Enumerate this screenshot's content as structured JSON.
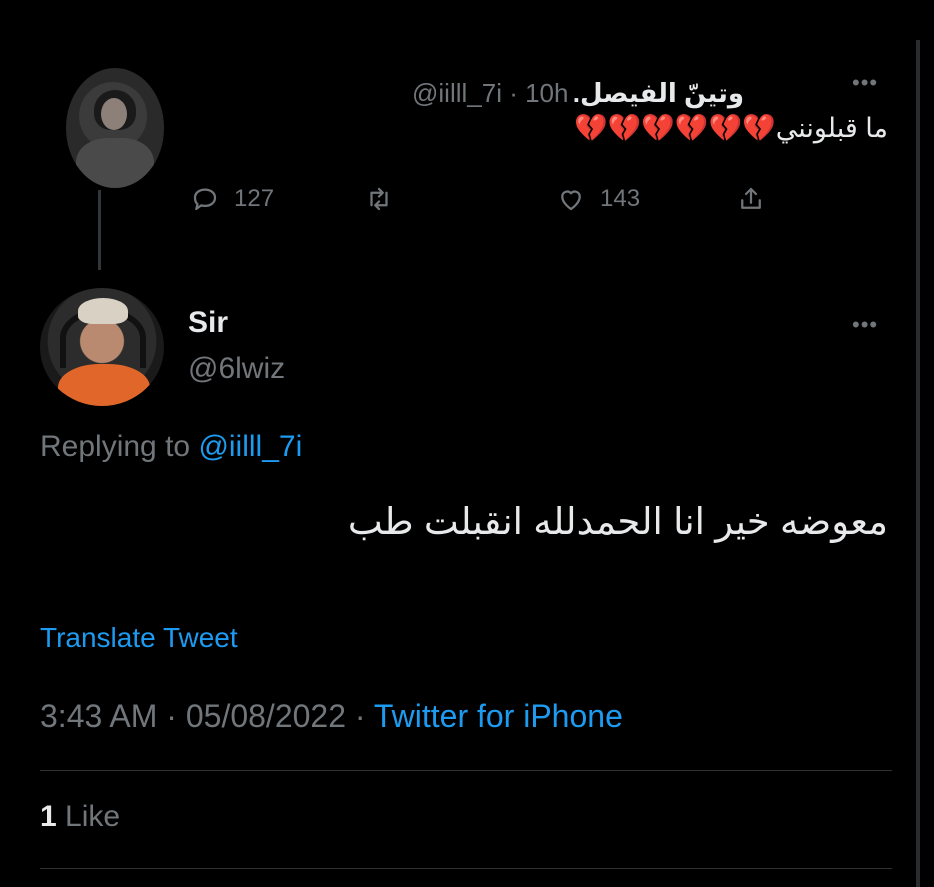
{
  "parent": {
    "display_name": "وتينّ الفيصل.",
    "handle_time": "@iilll_7i · 10h",
    "text": "ما قبلونني💔💔💔💔💔💔",
    "replies": "127",
    "likes": "143"
  },
  "reply": {
    "display_name": "Sir",
    "handle": "@6lwiz",
    "replying_prefix": "Replying to",
    "replying_handle": "@iilll_7i",
    "text": "معوضه خير انا الحمدلله انقبلت طب",
    "translate_label": "Translate Tweet",
    "time_date": "3:43 AM · 05/08/2022 · ",
    "source": "Twitter for iPhone",
    "like_count": "1",
    "like_label": "Like"
  },
  "icons": {
    "reply": "speech-bubble",
    "retweet": "retweet-arrows",
    "like": "heart",
    "share": "share-up-arrow",
    "more": "horizontal-ellipsis"
  },
  "colors": {
    "background": "#000000",
    "text": "#e7e9ea",
    "muted": "#71767b",
    "link": "#1d9bf0"
  }
}
